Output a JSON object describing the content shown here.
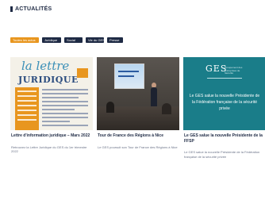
{
  "section": {
    "title": "ACTUALITÉS"
  },
  "filters": [
    {
      "label": "Toutes les actus"
    },
    {
      "label": "Juridique"
    },
    {
      "label": "Social"
    },
    {
      "label": "Vie du GES"
    },
    {
      "label": "Presse"
    }
  ],
  "cards": [
    {
      "title": "Lettre d'information juridique – Mars 2022",
      "description": "Retrouvez la Lettre Juridique du GES du 1er trimestre 2022",
      "image": {
        "kind": "newsletter-cover",
        "line1": "la lettre",
        "line2": "JURIDIQUE"
      }
    },
    {
      "title": "Tour de France des Régions à Nice",
      "description": "Le GES poursuit son Tour de France des Régions à Nice",
      "image": {
        "kind": "conference-photo"
      }
    },
    {
      "title": "Le GES salue la nouvelle Présidente de la FFSP",
      "description": "Le GES salue la nouvelle Présidente de la Fédération française de la sécurité privée",
      "image": {
        "kind": "ges-banner",
        "logo": "GES",
        "logo_sub": "Groupement des Entreprises de Sécurité",
        "caption": "Le GES salue la nouvelle Présidente de la Fédération française de la sécurité privée"
      }
    }
  ],
  "colors": {
    "accent": "#e8961f",
    "navy": "#1e2a44",
    "teal": "#1a7d89"
  }
}
